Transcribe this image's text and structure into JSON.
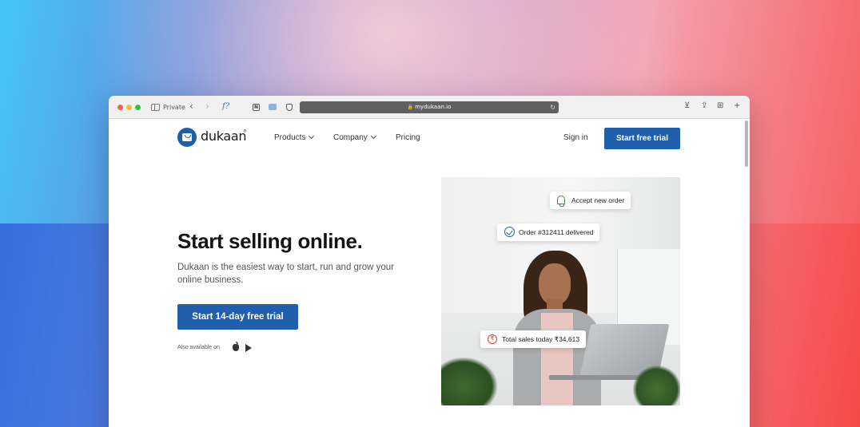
{
  "browser": {
    "mode_label": "Private",
    "url": "mydukaan.io",
    "fx_label": "f?"
  },
  "nav": {
    "brand": "dukaan",
    "brand_mark": "®",
    "items": [
      {
        "label": "Products"
      },
      {
        "label": "Company"
      },
      {
        "label": "Pricing"
      }
    ],
    "sign_in": "Sign in",
    "cta": "Start free trial"
  },
  "hero": {
    "title": "Start selling online.",
    "subtitle": "Dukaan is the easiest way to start, run and grow your online business.",
    "cta": "Start 14-day free trial",
    "available_on": "Also available on"
  },
  "notifications": {
    "accept": "Accept new order",
    "delivered": "Order #312411 delivered",
    "sales": "Total sales today ₹34,613"
  },
  "icons": {
    "rupee_symbol": "₹"
  },
  "colors": {
    "brand_blue": "#1f5fab",
    "bell_green": "#3d8a55",
    "rupee_red": "#d0453f"
  }
}
